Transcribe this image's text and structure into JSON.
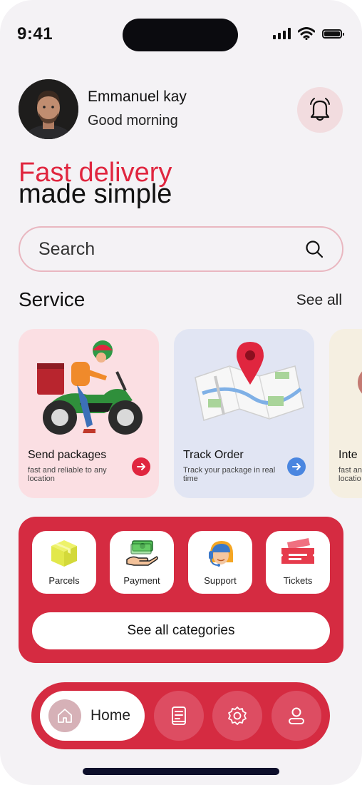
{
  "status_bar": {
    "time": "9:41"
  },
  "header": {
    "user_name": "Emmanuel kay",
    "greeting": "Good morning",
    "avatar_icon": "user-avatar-photo",
    "notification_icon": "bell-icon"
  },
  "hero": {
    "line1": "Fast delivery",
    "line2": "made simple"
  },
  "search": {
    "placeholder": "Search",
    "icon": "search-icon"
  },
  "services": {
    "title": "Service",
    "see_all": "See all",
    "cards": [
      {
        "title": "Send packages",
        "description": "fast and reliable to any location",
        "accent": "#e0263f",
        "art": "delivery-scooter-illustration"
      },
      {
        "title": "Track Order",
        "description": "Track your package in real time",
        "accent": "#4a86e0",
        "art": "map-pin-illustration"
      },
      {
        "title": "Inte",
        "description": "fast an locatio",
        "accent": "#e0263f",
        "art": "partial-card"
      }
    ]
  },
  "categories": {
    "items": [
      {
        "label": "Parcels",
        "icon": "parcel-box-icon"
      },
      {
        "label": "Payment",
        "icon": "cash-hand-icon"
      },
      {
        "label": "Support",
        "icon": "support-agent-icon"
      },
      {
        "label": "Tickets",
        "icon": "ticket-icon"
      }
    ],
    "see_all_label": "See all categories"
  },
  "tab_bar": {
    "home_label": "Home",
    "tabs": [
      {
        "icon": "home-icon",
        "active": true
      },
      {
        "icon": "document-icon",
        "active": false
      },
      {
        "icon": "settings-icon",
        "active": false
      },
      {
        "icon": "profile-icon",
        "active": false
      }
    ]
  },
  "colors": {
    "primary": "#d52b41",
    "accent_red": "#e0263f",
    "background": "#f4f2f5"
  }
}
